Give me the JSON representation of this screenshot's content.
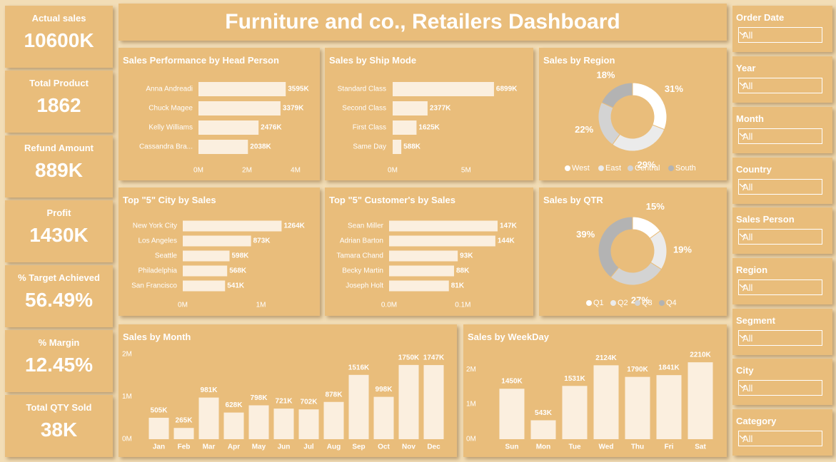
{
  "dashboard_title": "Furniture and co., Retailers Dashboard",
  "kpis": [
    {
      "label": "Actual sales",
      "value": "10600K"
    },
    {
      "label": "Total Product",
      "value": "1862"
    },
    {
      "label": "Refund Amount",
      "value": "889K"
    },
    {
      "label": "Profit",
      "value": "1430K"
    },
    {
      "label": "% Target Achieved",
      "value": "56.49%"
    },
    {
      "label": "% Margin",
      "value": "12.45%"
    },
    {
      "label": "Total QTY Sold",
      "value": "38K"
    }
  ],
  "slicers": [
    {
      "label": "Order Date",
      "value": "All"
    },
    {
      "label": "Year",
      "value": "All"
    },
    {
      "label": "Month",
      "value": "All"
    },
    {
      "label": "Country",
      "value": "All"
    },
    {
      "label": "Sales Person",
      "value": "All"
    },
    {
      "label": "Region",
      "value": "All"
    },
    {
      "label": "Segment",
      "value": "All"
    },
    {
      "label": "City",
      "value": "All"
    },
    {
      "label": "Category",
      "value": "All"
    }
  ],
  "colors": {
    "background": "#f2ddb6",
    "card": "#e9bd7b",
    "bar": "#fbefdf",
    "text": "#ffffff",
    "donut": [
      "#ffffff",
      "#ebebeb",
      "#d3d3d3",
      "#b3b3b3"
    ]
  },
  "chart_data": [
    {
      "id": "head-person",
      "type": "bar",
      "orientation": "horizontal",
      "title": "Sales Performance by Head Person",
      "categories": [
        "Anna Andreadi",
        "Chuck Magee",
        "Kelly Williams",
        "Cassandra Bra..."
      ],
      "values": [
        3595,
        3379,
        2476,
        2038
      ],
      "value_labels": [
        "3595K",
        "3379K",
        "2476K",
        "2038K"
      ],
      "xlim": [
        0,
        4000
      ],
      "ticks": [
        "0M",
        "2M",
        "4M"
      ]
    },
    {
      "id": "ship-mode",
      "type": "bar",
      "orientation": "horizontal",
      "title": "Sales by Ship Mode",
      "categories": [
        "Standard Class",
        "Second Class",
        "First Class",
        "Same Day"
      ],
      "values": [
        6899,
        2377,
        1625,
        588
      ],
      "value_labels": [
        "6899K",
        "2377K",
        "1625K",
        "588K"
      ],
      "xlim": [
        0,
        7000
      ],
      "ticks": [
        "0M",
        "5M"
      ]
    },
    {
      "id": "region",
      "type": "pie",
      "title": "Sales by Region",
      "categories": [
        "West",
        "East",
        "Central",
        "South"
      ],
      "values": [
        31,
        29,
        22,
        18
      ],
      "value_labels": [
        "31%",
        "29%",
        "22%",
        "18%"
      ]
    },
    {
      "id": "top-city",
      "type": "bar",
      "orientation": "horizontal",
      "title": "Top \"5\" City by Sales",
      "categories": [
        "New York City",
        "Los Angeles",
        "Seattle",
        "Philadelphia",
        "San Francisco"
      ],
      "values": [
        1264,
        873,
        598,
        568,
        541
      ],
      "value_labels": [
        "1264K",
        "873K",
        "598K",
        "568K",
        "541K"
      ],
      "xlim": [
        0,
        1260
      ],
      "ticks": [
        "0M",
        "1M"
      ]
    },
    {
      "id": "top-customer",
      "type": "bar",
      "orientation": "horizontal",
      "title": "Top \"5\" Customer's by Sales",
      "categories": [
        "Sean Miller",
        "Adrian Barton",
        "Tamara Chand",
        "Becky Martin",
        "Joseph Holt"
      ],
      "values": [
        147,
        144,
        93,
        88,
        81
      ],
      "value_labels": [
        "147K",
        "144K",
        "93K",
        "88K",
        "81K"
      ],
      "xlim": [
        0,
        148
      ],
      "ticks": [
        "0.0M",
        "0.1M"
      ]
    },
    {
      "id": "qtr",
      "type": "pie",
      "title": "Sales by QTR",
      "categories": [
        "Q1",
        "Q2",
        "Q3",
        "Q4"
      ],
      "values": [
        15,
        19,
        27,
        39
      ],
      "value_labels": [
        "15%",
        "19%",
        "27%",
        "39%"
      ]
    },
    {
      "id": "month",
      "type": "bar",
      "orientation": "vertical",
      "title": "Sales by Month",
      "categories": [
        "Jan",
        "Feb",
        "Mar",
        "Apr",
        "May",
        "Jun",
        "Jul",
        "Aug",
        "Sep",
        "Oct",
        "Nov",
        "Dec"
      ],
      "values": [
        505,
        265,
        981,
        628,
        798,
        721,
        702,
        878,
        1516,
        998,
        1750,
        1747
      ],
      "value_labels": [
        "505K",
        "265K",
        "981K",
        "628K",
        "798K",
        "721K",
        "702K",
        "878K",
        "1516K",
        "998K",
        "1750K",
        "1747K"
      ],
      "ylim": [
        0,
        2000
      ],
      "ticks": [
        "0M",
        "1M",
        "2M"
      ]
    },
    {
      "id": "weekday",
      "type": "bar",
      "orientation": "vertical",
      "title": "Sales by WeekDay",
      "categories": [
        "Sun",
        "Mon",
        "Tue",
        "Wed",
        "Thu",
        "Fri",
        "Sat"
      ],
      "values": [
        1450,
        543,
        1531,
        2124,
        1790,
        1841,
        2210
      ],
      "value_labels": [
        "1450K",
        "543K",
        "1531K",
        "2124K",
        "1790K",
        "1841K",
        "2210K"
      ],
      "ylim": [
        0,
        2500
      ],
      "ticks": [
        "0M",
        "1M",
        "2M"
      ]
    }
  ]
}
